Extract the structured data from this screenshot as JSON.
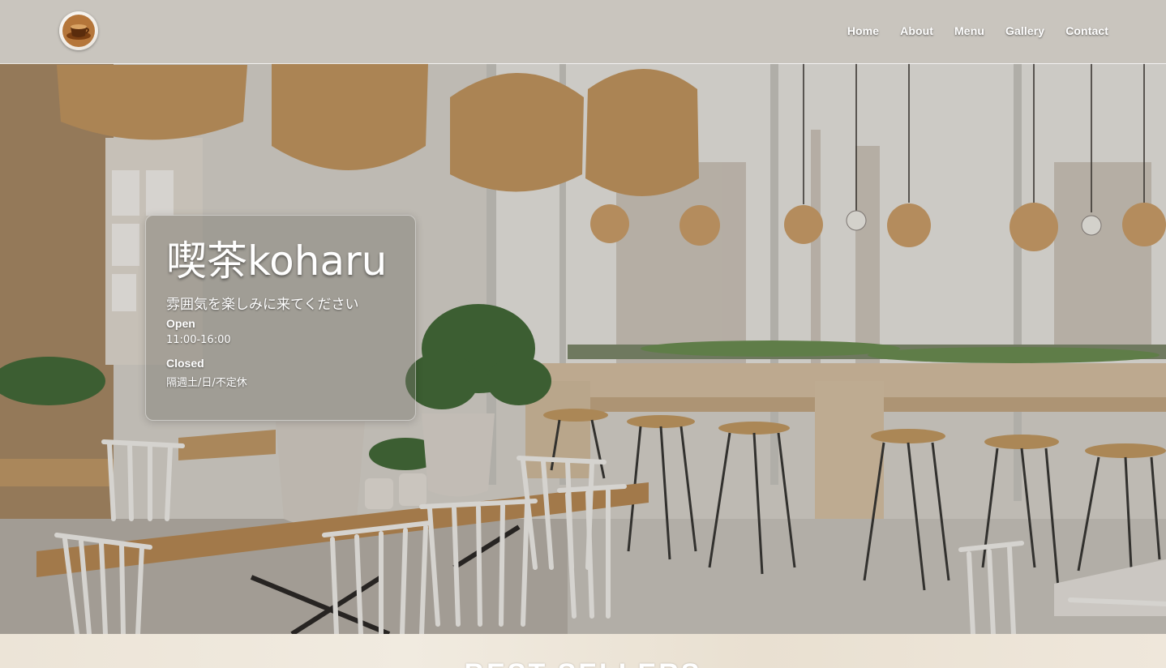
{
  "nav": {
    "logo_icon": "coffee-cup-icon",
    "links": [
      {
        "label": "Home"
      },
      {
        "label": "About"
      },
      {
        "label": "Menu"
      },
      {
        "label": "Gallery"
      },
      {
        "label": "Contact"
      }
    ]
  },
  "hero": {
    "shop_name": "喫茶koharu",
    "tagline": "雰囲気を楽しみに来てください",
    "open_label": "Open",
    "open_hours": "11:00-16:00",
    "closed_label": "Closed",
    "closed_days": "隔週土/日/不定休"
  },
  "next_section": {
    "heading": "BEST SELLERS"
  },
  "colors": {
    "nav_bg": "#d2cdc6",
    "card_bg": "#78746c",
    "text": "#ffffff",
    "section_bg": "#efe8de"
  }
}
